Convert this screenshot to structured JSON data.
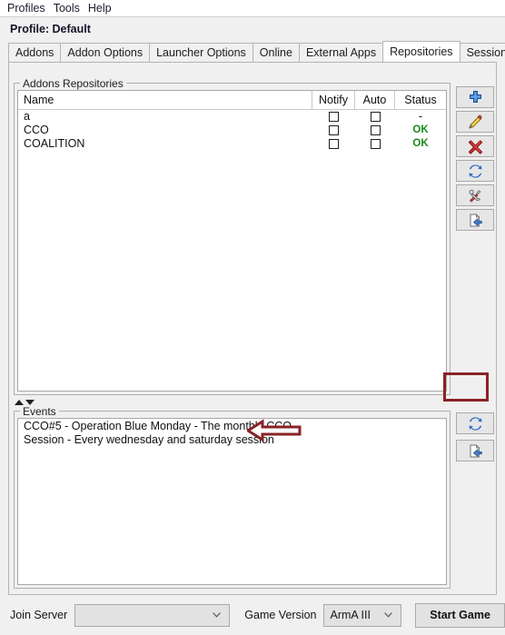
{
  "menubar": {
    "items": [
      {
        "label": "Profiles"
      },
      {
        "label": "Tools"
      },
      {
        "label": "Help"
      }
    ]
  },
  "profile": {
    "label": "Profile: Default"
  },
  "tabs": [
    {
      "label": "Addons",
      "selected": false,
      "closable": false
    },
    {
      "label": "Addon Options",
      "selected": false,
      "closable": false
    },
    {
      "label": "Launcher Options",
      "selected": false,
      "closable": false
    },
    {
      "label": "Online",
      "selected": false,
      "closable": false
    },
    {
      "label": "External Apps",
      "selected": false,
      "closable": false
    },
    {
      "label": "Repositories",
      "selected": true,
      "closable": false
    },
    {
      "label": "Session",
      "selected": false,
      "closable": true
    }
  ],
  "repositories": {
    "group_title": "Addons Repositories",
    "columns": [
      "Name",
      "Notify",
      "Auto",
      "Status"
    ],
    "rows": [
      {
        "name": "a",
        "notify": false,
        "auto": false,
        "status": "-"
      },
      {
        "name": "CCO",
        "notify": false,
        "auto": false,
        "status": "OK"
      },
      {
        "name": "COALITION",
        "notify": false,
        "auto": false,
        "status": "OK"
      }
    ],
    "status_ok_color": "#1a8a1a",
    "toolbar": [
      {
        "name": "add-repository-button",
        "icon": "plus-icon",
        "tooltip": "Add"
      },
      {
        "name": "edit-repository-button",
        "icon": "pencil-icon",
        "tooltip": "Edit"
      },
      {
        "name": "delete-repository-button",
        "icon": "red-x-icon",
        "tooltip": "Delete"
      },
      {
        "name": "refresh-repository-button",
        "icon": "refresh-icon",
        "tooltip": "Refresh"
      },
      {
        "name": "repository-tools-button",
        "icon": "wrench-screwdriver-icon",
        "tooltip": "Tools"
      },
      {
        "name": "import-repository-button",
        "icon": "import-page-icon",
        "tooltip": "Import"
      }
    ]
  },
  "splitter": {
    "up_icon": "triangle-up-icon",
    "down_icon": "triangle-down-icon"
  },
  "events": {
    "group_title": "Events",
    "rows": [
      {
        "text": "CCO#5 - Operation Blue Monday - The monthly CCO"
      },
      {
        "text": "Session - Every wednesday and saturday session"
      }
    ],
    "toolbar": [
      {
        "name": "refresh-events-button",
        "icon": "refresh-icon",
        "tooltip": "Refresh"
      },
      {
        "name": "import-event-button",
        "icon": "import-page-icon",
        "tooltip": "Import"
      }
    ]
  },
  "annotations": {
    "arrow_color": "#8a2225",
    "highlight_color": "#8a2225"
  },
  "bottombar": {
    "join_server_label": "Join Server",
    "join_server_value": "",
    "game_version_label": "Game Version",
    "game_version_value": "ArmA III",
    "start_button_label": "Start Game"
  }
}
